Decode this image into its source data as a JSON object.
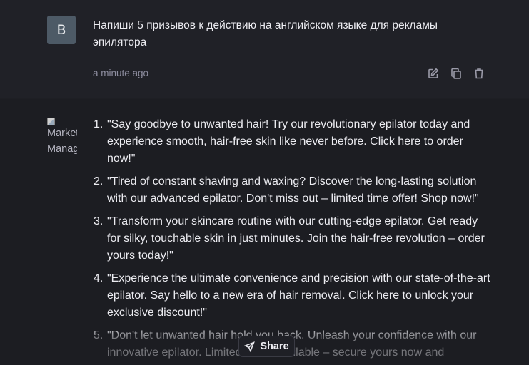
{
  "user_message": {
    "avatar_letter": "B",
    "text": "Напиши 5 призывов к действию на английском языке для рекламы эпилятора",
    "timestamp": "a minute ago",
    "actions": [
      "edit-icon",
      "copy-icon",
      "delete-icon"
    ]
  },
  "assistant_message": {
    "avatar_alt": "Marketing Manager",
    "items": [
      {
        "num": "1.",
        "text": "\"Say goodbye to unwanted hair! Try our revolutionary epilator today and experience smooth, hair-free skin like never before. Click here to order now!\""
      },
      {
        "num": "2.",
        "text": "\"Tired of constant shaving and waxing? Discover the long-lasting solution with our advanced epilator. Don't miss out – limited time offer! Shop now!\""
      },
      {
        "num": "3.",
        "text": "\"Transform your skincare routine with our cutting-edge epilator. Get ready for silky, touchable skin in just minutes. Join the hair-free revolution – order yours today!\""
      },
      {
        "num": "4.",
        "text": "\"Experience the ultimate convenience and precision with our state-of-the-art epilator. Say hello to a new era of hair removal. Click here to unlock your exclusive discount!\""
      },
      {
        "num": "5.",
        "text": "\"Don't let unwanted hair hold you back. Unleash your confidence with our innovative epilator. Limited stock available – secure yours now and"
      }
    ]
  },
  "share_button": {
    "label": "Share",
    "icon": "send-icon"
  }
}
